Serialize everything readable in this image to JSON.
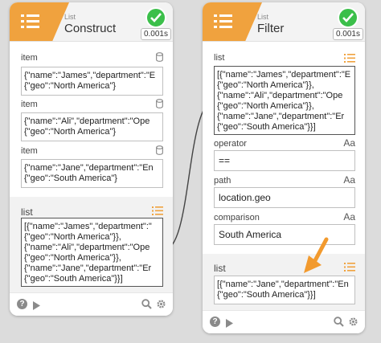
{
  "colors": {
    "accent": "#f0a23e",
    "success": "#3bbf4a",
    "arrow": "#f29a2e"
  },
  "icons": {
    "node_icon": "list-icon",
    "status": "check-icon",
    "item_field": "cylinder-icon",
    "list_field": "list-lines-icon",
    "text_field": "text-type-icon",
    "footer": [
      "help-icon",
      "play-icon",
      "search-icon",
      "gear-icon"
    ]
  },
  "construct": {
    "subtitle": "List",
    "title": "Construct",
    "time": "0.001s",
    "items": [
      {
        "label": "item",
        "value": "{\"name\":\"James\",\"department\":\"E\n{\"geo\":\"North America\"}"
      },
      {
        "label": "item",
        "value": "{\"name\":\"Ali\",\"department\":\"Ope\n{\"geo\":\"North America\"}"
      },
      {
        "label": "item",
        "value": "{\"name\":\"Jane\",\"department\":\"En\n{\"geo\":\"South America\"}"
      }
    ],
    "list": {
      "label": "list",
      "value": "[{\"name\":\"James\",\"department\":\"\n{\"geo\":\"North America\"}},\n{\"name\":\"Ali\",\"department\":\"Ope\n{\"geo\":\"North America\"}},\n{\"name\":\"Jane\",\"department\":\"Er\n{\"geo\":\"South America\"}}]"
    }
  },
  "filter": {
    "subtitle": "List",
    "title": "Filter",
    "time": "0.001s",
    "list_in": {
      "label": "list",
      "value": "[{\"name\":\"James\",\"department\":\"E\n{\"geo\":\"North America\"}},\n{\"name\":\"Ali\",\"department\":\"Ope\n{\"geo\":\"North America\"}},\n{\"name\":\"Jane\",\"department\":\"Er\n{\"geo\":\"South America\"}}]"
    },
    "operator": {
      "label": "operator",
      "value": "==",
      "icon_text": "Aa"
    },
    "path": {
      "label": "path",
      "value": "location.geo",
      "icon_text": "Aa"
    },
    "comparison": {
      "label": "comparison",
      "value": "South America",
      "icon_text": "Aa"
    },
    "list_out": {
      "label": "list",
      "value": "[{\"name\":\"Jane\",\"department\":\"En\n{\"geo\":\"South America\"}}]"
    }
  }
}
